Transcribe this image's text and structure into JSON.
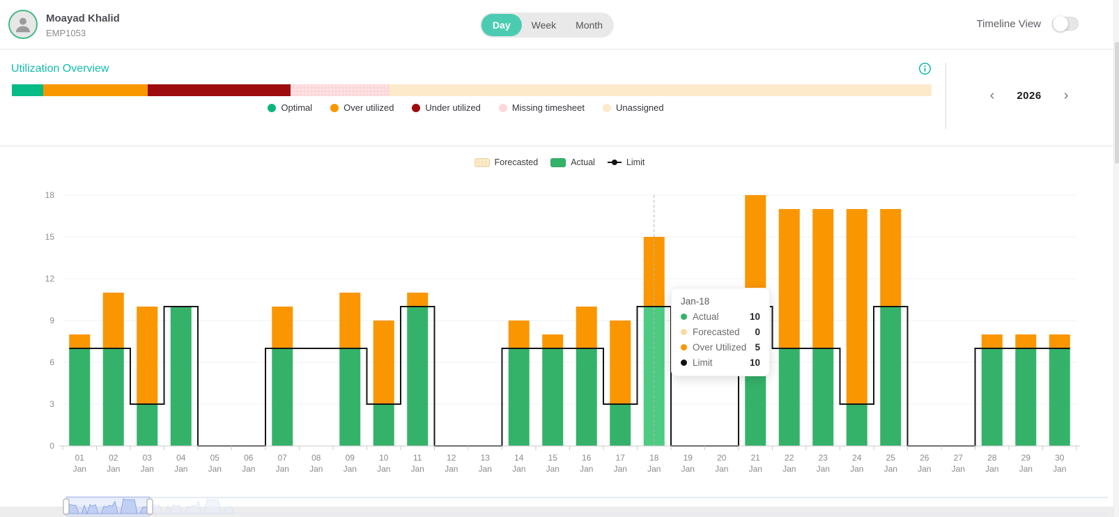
{
  "header": {
    "user": {
      "name": "Moayad Khalid",
      "employee_id": "EMP1053"
    },
    "period_toggle": {
      "day": "Day",
      "week": "Week",
      "month": "Month",
      "active": "Day"
    },
    "timeline": {
      "label": "Timeline View",
      "enabled": false
    }
  },
  "overview": {
    "title": "Utilization Overview",
    "bar_segments": [
      {
        "label": "Optimal",
        "color": "#06bb86",
        "width_pct": 3.4
      },
      {
        "label": "Over utilized",
        "color": "#f99700",
        "width_pct": 11.4
      },
      {
        "label": "Under utilized",
        "color": "#9e0c10",
        "width_pct": 15.5
      },
      {
        "label": "Missing timesheet",
        "color": "#fdd8da",
        "width_pct": 10.8,
        "pattern": "dots"
      },
      {
        "label": "Unassigned",
        "color": "#fceacb",
        "width_pct": 58.9
      }
    ],
    "legend": [
      {
        "label": "Optimal",
        "color": "#0cb57e"
      },
      {
        "label": "Over utilized",
        "color": "#f99700"
      },
      {
        "label": "Under utilized",
        "color": "#9e0c10"
      },
      {
        "label": "Missing timesheet",
        "color": "#fdd8da"
      },
      {
        "label": "Unassigned",
        "color": "#fceacb"
      }
    ],
    "year_nav": {
      "prev": "‹",
      "year": "2026",
      "next": "›"
    }
  },
  "chart_legend": [
    {
      "label": "Forecasted",
      "color": "#fbe3b9",
      "style": "dotted-swatch"
    },
    {
      "label": "Actual",
      "color": "#35b26a",
      "style": "swatch"
    },
    {
      "label": "Limit",
      "color": "#141414",
      "style": "line-dot"
    }
  ],
  "chart_data": {
    "type": "bar",
    "stacked": true,
    "month": "Jan",
    "categories": [
      "01",
      "02",
      "03",
      "04",
      "05",
      "06",
      "07",
      "08",
      "09",
      "10",
      "11",
      "12",
      "13",
      "14",
      "15",
      "16",
      "17",
      "18",
      "19",
      "20",
      "21",
      "22",
      "23",
      "24",
      "25",
      "26",
      "27",
      "28",
      "29",
      "30"
    ],
    "series": [
      {
        "name": "Actual",
        "color": "#35b26a",
        "highlight_color": "#4ecb82",
        "values": [
          7,
          7,
          3,
          10,
          0,
          0,
          7,
          0,
          7,
          3,
          10,
          0,
          0,
          7,
          7,
          7,
          3,
          10,
          0,
          0,
          10,
          7,
          7,
          3,
          10,
          0,
          0,
          7,
          7,
          7
        ]
      },
      {
        "name": "Forecasted",
        "color": "#fbe3b9",
        "values": [
          0,
          0,
          0,
          0,
          0,
          0,
          0,
          0,
          0,
          0,
          0,
          0,
          0,
          0,
          0,
          0,
          0,
          0,
          0,
          0,
          0,
          0,
          0,
          0,
          0,
          0,
          0,
          0,
          0,
          0
        ]
      },
      {
        "name": "Over Utilized",
        "color": "#fa9600",
        "values": [
          1,
          4,
          7,
          0,
          0,
          0,
          3,
          0,
          4,
          6,
          1,
          0,
          0,
          2,
          1,
          3,
          6,
          5,
          0,
          0,
          8,
          10,
          10,
          14,
          7,
          0,
          0,
          1,
          1,
          1
        ]
      },
      {
        "name": "Limit",
        "render": "step-line",
        "color": "#141414",
        "values": [
          7,
          7,
          3,
          10,
          0,
          0,
          7,
          7,
          7,
          3,
          10,
          0,
          0,
          7,
          7,
          7,
          3,
          10,
          0,
          0,
          10,
          7,
          7,
          3,
          10,
          0,
          0,
          7,
          7,
          7
        ]
      }
    ],
    "ylim": [
      0,
      18
    ],
    "yticks": [
      0,
      3,
      6,
      9,
      12,
      15,
      18
    ],
    "grid": true,
    "legend_position": "top",
    "highlight_index": 17
  },
  "tooltip": {
    "title": "Jan-18",
    "rows": [
      {
        "label": "Actual",
        "value": "10",
        "color": "#35b26a"
      },
      {
        "label": "Forecasted",
        "value": "0",
        "color": "#fbd9a3"
      },
      {
        "label": "Over Utilized",
        "value": "5",
        "color": "#fa9600"
      },
      {
        "label": "Limit",
        "value": "10",
        "color": "#111111"
      }
    ]
  }
}
